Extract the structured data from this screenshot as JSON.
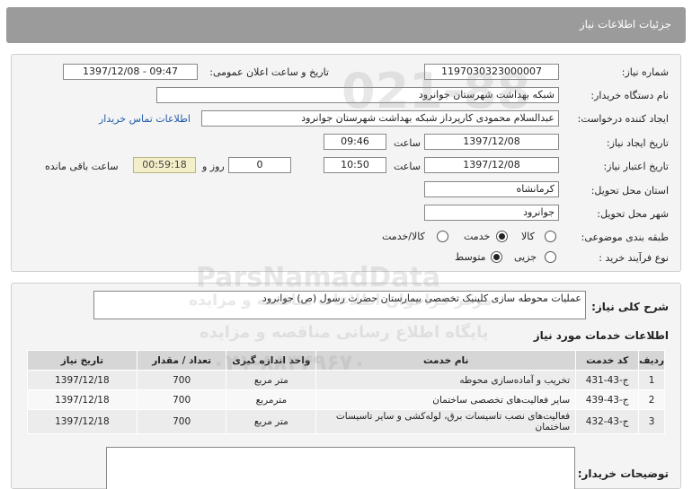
{
  "header": {
    "title": "جزئیات اطلاعات نیاز"
  },
  "form": {
    "need_number": {
      "label": "شماره نیاز:",
      "value": "1197030323000007"
    },
    "announce": {
      "label": "تاریخ و ساعت اعلان عمومی:",
      "value": "1397/12/08 - 09:47"
    },
    "buyer_org": {
      "label": "نام دستگاه خریدار:",
      "value": "شبکه بهداشت شهرستان جوانرود"
    },
    "requester": {
      "label": "ایجاد کننده درخواست:",
      "value": "عبدالسلام محمودی کارپرداز شبکه بهداشت شهرستان جوانرود"
    },
    "contact_link": "اطلاعات تماس خریدار",
    "created": {
      "label": "تاریخ ایجاد نیاز:",
      "date": "1397/12/08",
      "time_label": "ساعت",
      "time": "09:46"
    },
    "validity": {
      "label": "تاریخ اعتبار نیاز:",
      "date": "1397/12/08",
      "time_label": "ساعت",
      "time": "10:50",
      "days": "0",
      "days_label": "روز و",
      "remaining": "00:59:18",
      "remaining_label": "ساعت باقی مانده"
    },
    "province": {
      "label": "استان محل تحویل:",
      "value": "کرمانشاه"
    },
    "city": {
      "label": "شهر محل تحویل:",
      "value": "جوانرود"
    },
    "category": {
      "label": "طبقه بندی موضوعی:",
      "options": [
        "کالا",
        "خدمت",
        "کالا/خدمت"
      ],
      "selected": "خدمت"
    },
    "process": {
      "label": "نوع فرآیند خرید :",
      "options": [
        "جزیی",
        "متوسط"
      ],
      "selected": "متوسط"
    }
  },
  "summary": {
    "label": "شرح کلی نیاز:",
    "value": "عملیات محوطه سازی کلینیک تخصصی بیمارستان حضرت رسول (ص) جوانرود"
  },
  "services": {
    "title": "اطلاعات خدمات مورد نیاز",
    "columns": [
      "ردیف",
      "کد خدمت",
      "نام خدمت",
      "واحد اندازه گیری",
      "تعداد / مقدار",
      "تاریخ نیاز"
    ],
    "rows": [
      [
        "1",
        "ج-43-431",
        "تخریب و آماده‌سازی محوطه",
        "متر مربع",
        "700",
        "1397/12/18"
      ],
      [
        "2",
        "ج-43-439",
        "سایر فعالیت‌های تخصصی ساختمان",
        "مترمربع",
        "700",
        "1397/12/18"
      ],
      [
        "3",
        "ج-43-432",
        "فعالیت‌های نصب تاسیسات برق، لوله‌کشی و سایر تاسیسات ساختمان",
        "متر مربع",
        "700",
        "1397/12/18"
      ]
    ]
  },
  "buyer_notes": {
    "label": "توضیحات خریدار:",
    "value": ""
  },
  "watermarks": [
    "ParsNamadData",
    "مرکز فراخوان اطلاعات مناقصه و مزایده",
    "پایگاه اطلاع رسانی مناقصه و مزایده",
    "۰۲۱-۸۸۳۴۹۶۷۰",
    "021-88"
  ],
  "colors": {
    "header": "#9b9b9b",
    "panel": "#f4f4f4",
    "link": "#1f5aa8",
    "countdown": "#f3efc8"
  }
}
